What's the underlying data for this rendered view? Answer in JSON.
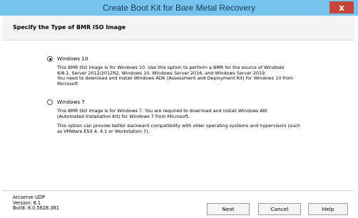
{
  "window": {
    "title": "Create Boot Kit for Bare Metal Recovery",
    "close_glyph": "x"
  },
  "page": {
    "heading": "Specify the Type of BMR ISO Image"
  },
  "options": [
    {
      "label": "Windows 10",
      "selected": true,
      "description_lines": [
        "This BMR ISO image is for Windows 10. Use this option to perform a BMR for the source of Windows",
        "8/8.1, Server 2012/2012R2, Windows 10, Windows Server 2016, and Windows Server 2019.",
        "You need to download and install Windows ADK (Assessment and Deployment Kit) for Windows 10 from",
        "Microsoft."
      ]
    },
    {
      "label": "Windows 7",
      "selected": false,
      "description_lines": [
        "This BMR ISO image is for Windows 7. You are required to download and install Windows AIK",
        "(Automated Installation Kit) for Windows 7 from Microsoft."
      ],
      "extra_lines": [
        "This option can provide better backward compatibility with older operating systems and hypervisors (such",
        "as VMWare ESX 4. 4.1 or Workstation 7)."
      ]
    }
  ],
  "footer": {
    "product": "Arcserve UDP",
    "version": "Version: 8.1",
    "build": "Build: 8.0.5628.381"
  },
  "buttons": {
    "next": "Next",
    "cancel": "Cancel",
    "help": "Help"
  },
  "colors": {
    "titlebar": "#75c4ee",
    "close": "#c7443a"
  }
}
